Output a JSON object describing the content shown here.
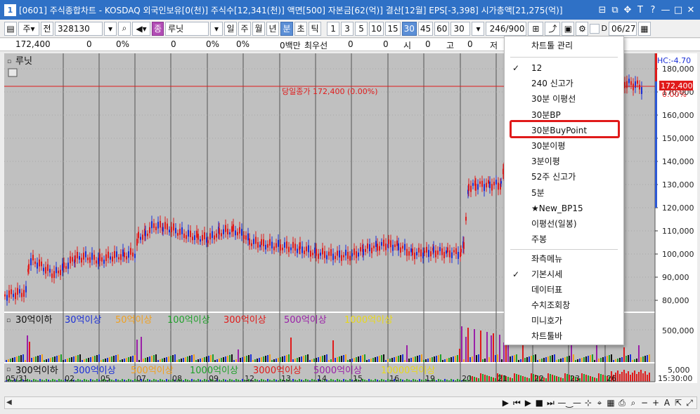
{
  "window": {
    "number": "1",
    "title": "[0601] 주식종합차트 - KOSDAQ 외국인보유[0(천)] 주식수[12,341(천)] 액면[500] 자본금[62(억)] 결산[12월] EPS[-3,398] 시가총액[21,275(억)] ",
    "buttons": [
      "⊟",
      "⧉",
      "✥",
      "T",
      "?",
      "—",
      "□",
      "✕"
    ]
  },
  "toolbar": {
    "mode1": "주",
    "mode2": "전",
    "code": "328130",
    "name": "루닛",
    "badge": "종",
    "periods": [
      "일",
      "주",
      "월",
      "년",
      "분",
      "초",
      "틱"
    ],
    "selected_period": "분",
    "intervals": [
      "1",
      "3",
      "5",
      "10",
      "15",
      "30",
      "45",
      "60"
    ],
    "selected_interval": "30",
    "interval_value": "30",
    "count": "246",
    "count_max": "/900",
    "date": "06/27",
    "d_label": "D"
  },
  "info": {
    "price": "172,400",
    "chg": "0",
    "pct": "0%",
    "vol": "0",
    "vpct": "0%",
    "v2": "0%",
    "unit": "0백만",
    "best_label": "최우선",
    "ask": "0",
    "bid": "0",
    "open_label": "시",
    "open": "0",
    "high_label": "고",
    "high": "0",
    "low_label": "저"
  },
  "chart": {
    "stock_name": "루닛",
    "close_label": "당일종가 172,400 (0.00%)",
    "price_tag": "172,400",
    "price_pct": "0.00%",
    "hc_label": "HC:-4.70",
    "y_ticks": [
      "180,000",
      "170,000",
      "160,000",
      "150,000",
      "140,000",
      "130,000",
      "120,000",
      "110,000",
      "100,000",
      "90,000",
      "80,000"
    ],
    "vol_ticks": [
      "500,000",
      "5,000"
    ],
    "time_labels": [
      "05/31",
      "02",
      "05",
      "07",
      "08",
      "09",
      "12",
      "13",
      "14",
      "15",
      "16",
      "19",
      "20",
      "21",
      "22",
      "23",
      "26",
      "15:30:00"
    ],
    "legend1": [
      {
        "text": "30억이하",
        "color": "#111111"
      },
      {
        "text": "30억이상",
        "color": "#1b2fd6"
      },
      {
        "text": "50억이상",
        "color": "#f0a020"
      },
      {
        "text": "100억이상",
        "color": "#1fa02a"
      },
      {
        "text": "300억이상",
        "color": "#e01a1a"
      },
      {
        "text": "500억이상",
        "color": "#9a1fa8"
      },
      {
        "text": "1000억이상",
        "color": "#e8d81a"
      }
    ],
    "legend2": [
      {
        "text": "300억이하",
        "color": "#111111"
      },
      {
        "text": "300억이상",
        "color": "#1b2fd6"
      },
      {
        "text": "500억이상",
        "color": "#f0a020"
      },
      {
        "text": "1000억이상",
        "color": "#1fa02a"
      },
      {
        "text": "3000억이상",
        "color": "#e01a1a"
      },
      {
        "text": "5000억이상",
        "color": "#9a1fa8"
      },
      {
        "text": "10000억이상",
        "color": "#e8d81a"
      }
    ]
  },
  "menu": {
    "header": "차트툴 관리",
    "items": [
      {
        "label": "12",
        "checked": true
      },
      {
        "label": "240 신고가",
        "checked": false
      },
      {
        "label": "30분 이평선",
        "checked": false
      },
      {
        "label": "30분BP",
        "checked": false
      },
      {
        "label": "30분BuyPoint",
        "checked": false,
        "highlighted": true
      },
      {
        "label": "30분이평",
        "checked": false
      },
      {
        "label": "3분이평",
        "checked": false
      },
      {
        "label": "52주 신고가",
        "checked": false
      },
      {
        "label": "5분",
        "checked": false
      },
      {
        "label": "★New_BP15",
        "checked": false
      },
      {
        "label": "이평선(일봉)",
        "checked": false
      },
      {
        "label": "주봉",
        "checked": false
      }
    ],
    "items2": [
      {
        "label": "좌측메뉴",
        "checked": false
      },
      {
        "label": "기본시세",
        "checked": true
      },
      {
        "label": "데이터표",
        "checked": false
      },
      {
        "label": "수치조회창",
        "checked": false
      },
      {
        "label": "미니호가",
        "checked": false
      },
      {
        "label": "차트툴바",
        "checked": false
      }
    ]
  },
  "colors": {
    "title_bg": "#2f71c6",
    "chart_bg": "#c0c0c0",
    "up": "#e01a1a",
    "down": "#1b2fd6",
    "highlight": "#e01a1a"
  }
}
